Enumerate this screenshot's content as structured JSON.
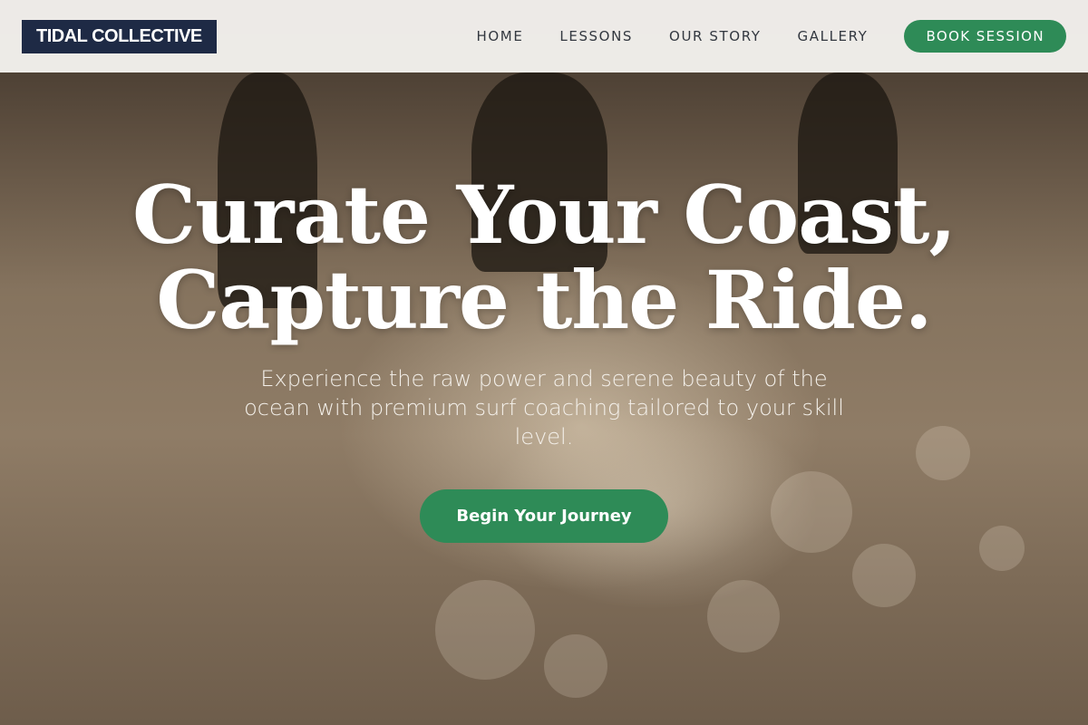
{
  "brand": {
    "logo_text": "TIDAL COLLECTIVE"
  },
  "nav": {
    "links": [
      {
        "label": "HOME"
      },
      {
        "label": "LESSONS"
      },
      {
        "label": "OUR STORY"
      },
      {
        "label": "GALLERY"
      }
    ],
    "cta_label": "BOOK SESSION"
  },
  "hero": {
    "title_line1": "Curate Your Coast,",
    "title_line2": "Capture the Ride.",
    "subtitle": "Experience the raw power and serene beauty of the ocean with premium surf coaching tailored to your skill level.",
    "cta_label": "Begin Your Journey",
    "background_image": "surfers-walking-beach-sunset"
  },
  "colors": {
    "accent": "#2e8b57",
    "logo_bg": "#1e2a45",
    "nav_bg": "#f3f1ed"
  }
}
